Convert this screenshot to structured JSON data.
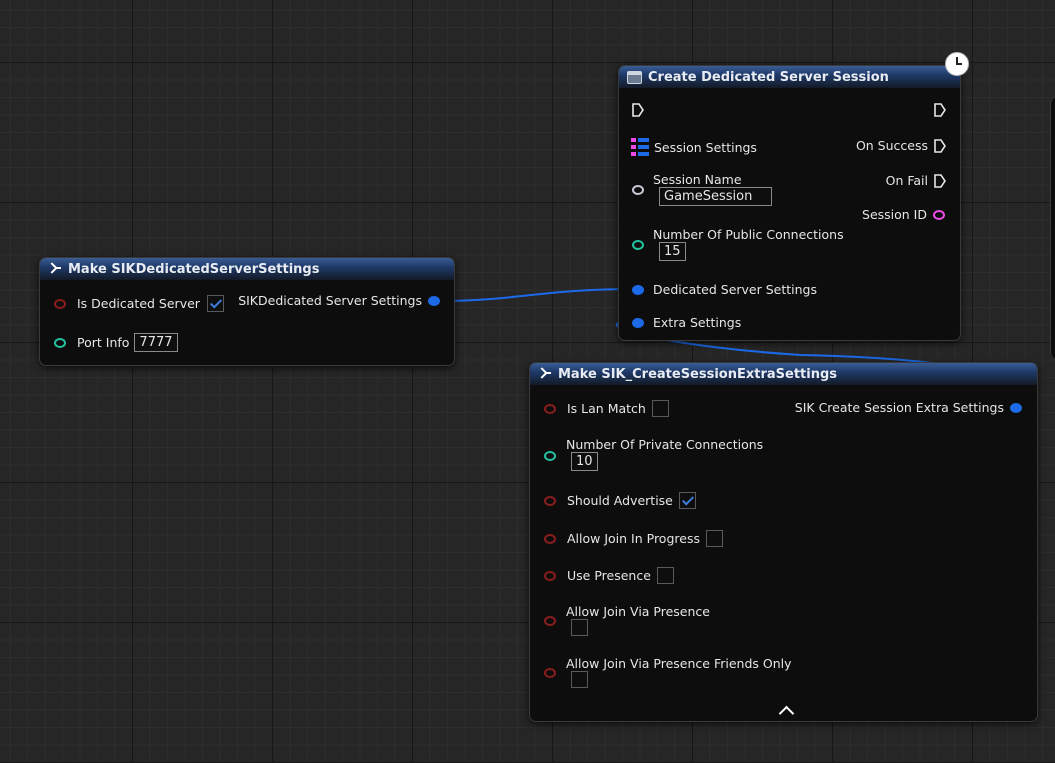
{
  "make_dedicated": {
    "title": "Make SIKDedicatedServerSettings",
    "is_dedicated_label": "Is Dedicated Server",
    "is_dedicated_checked": true,
    "port_label": "Port Info",
    "port_value": "7777",
    "output_label": "SIKDedicated Server Settings"
  },
  "create_session": {
    "title": "Create Dedicated Server Session",
    "session_settings_label": "Session Settings",
    "session_name_label": "Session Name",
    "session_name_value": "GameSession",
    "public_conn_label": "Number Of Public Connections",
    "public_conn_value": "15",
    "dedicated_settings_label": "Dedicated Server Settings",
    "extra_settings_label": "Extra Settings",
    "on_success_label": "On Success",
    "on_fail_label": "On Fail",
    "session_id_label": "Session ID"
  },
  "make_extra": {
    "title": "Make SIK_CreateSessionExtraSettings",
    "output_label": "SIK Create Session Extra Settings",
    "is_lan_label": "Is Lan Match",
    "is_lan_checked": false,
    "private_conn_label": "Number Of Private Connections",
    "private_conn_value": "10",
    "should_advertise_label": "Should Advertise",
    "should_advertise_checked": true,
    "allow_join_progress_label": "Allow Join In Progress",
    "allow_join_progress_checked": false,
    "use_presence_label": "Use Presence",
    "use_presence_checked": false,
    "allow_join_presence_label": "Allow Join Via Presence",
    "allow_join_presence_checked": false,
    "allow_join_friends_label": "Allow Join Via Presence Friends Only",
    "allow_join_friends_checked": false
  },
  "colors": {
    "bool_pin": "#8c1d1d",
    "int_pin": "#25c2a0",
    "struct_pin": "#1c6ae8",
    "string_pin": "#f04ae8",
    "name_pin": "#c7c9d6",
    "wire": "#1c6ae8"
  },
  "icons": {
    "struct_header": "make-struct-icon",
    "function_header": "function-icon",
    "latent": "clock-icon",
    "collapse": "chevron-up-icon"
  }
}
